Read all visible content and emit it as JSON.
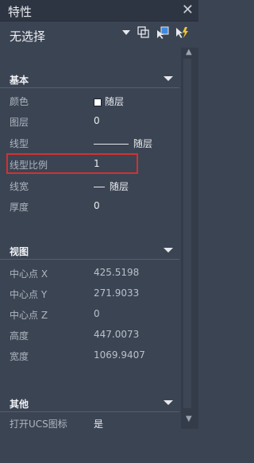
{
  "window": {
    "title": "特性",
    "close_glyph": "✕"
  },
  "selector": {
    "value": "无选择"
  },
  "sections": {
    "basic": {
      "title": "基本",
      "rows": [
        {
          "key": "颜色",
          "value": "随层"
        },
        {
          "key": "图层",
          "value": "0"
        },
        {
          "key": "线型",
          "value": "随层"
        },
        {
          "key": "线型比例",
          "value": "1"
        },
        {
          "key": "线宽",
          "value": "随层"
        },
        {
          "key": "厚度",
          "value": "0"
        }
      ]
    },
    "view": {
      "title": "视图",
      "rows": [
        {
          "key": "中心点 X",
          "value": "425.5198"
        },
        {
          "key": "中心点 Y",
          "value": "271.9033"
        },
        {
          "key": "中心点 Z",
          "value": "0"
        },
        {
          "key": "高度",
          "value": "447.0073"
        },
        {
          "key": "宽度",
          "value": "1069.9407"
        }
      ]
    },
    "other": {
      "title": "其他",
      "rows": [
        {
          "key": "打开UCS图标",
          "value": "是"
        }
      ]
    }
  },
  "colors": {
    "accent_highlight": "#d33131",
    "panel_bg": "#3b4453"
  },
  "icons": {
    "tool1": "quick-select-icon",
    "tool2": "select-objects-icon",
    "tool3": "toggle-pickadd-icon"
  }
}
